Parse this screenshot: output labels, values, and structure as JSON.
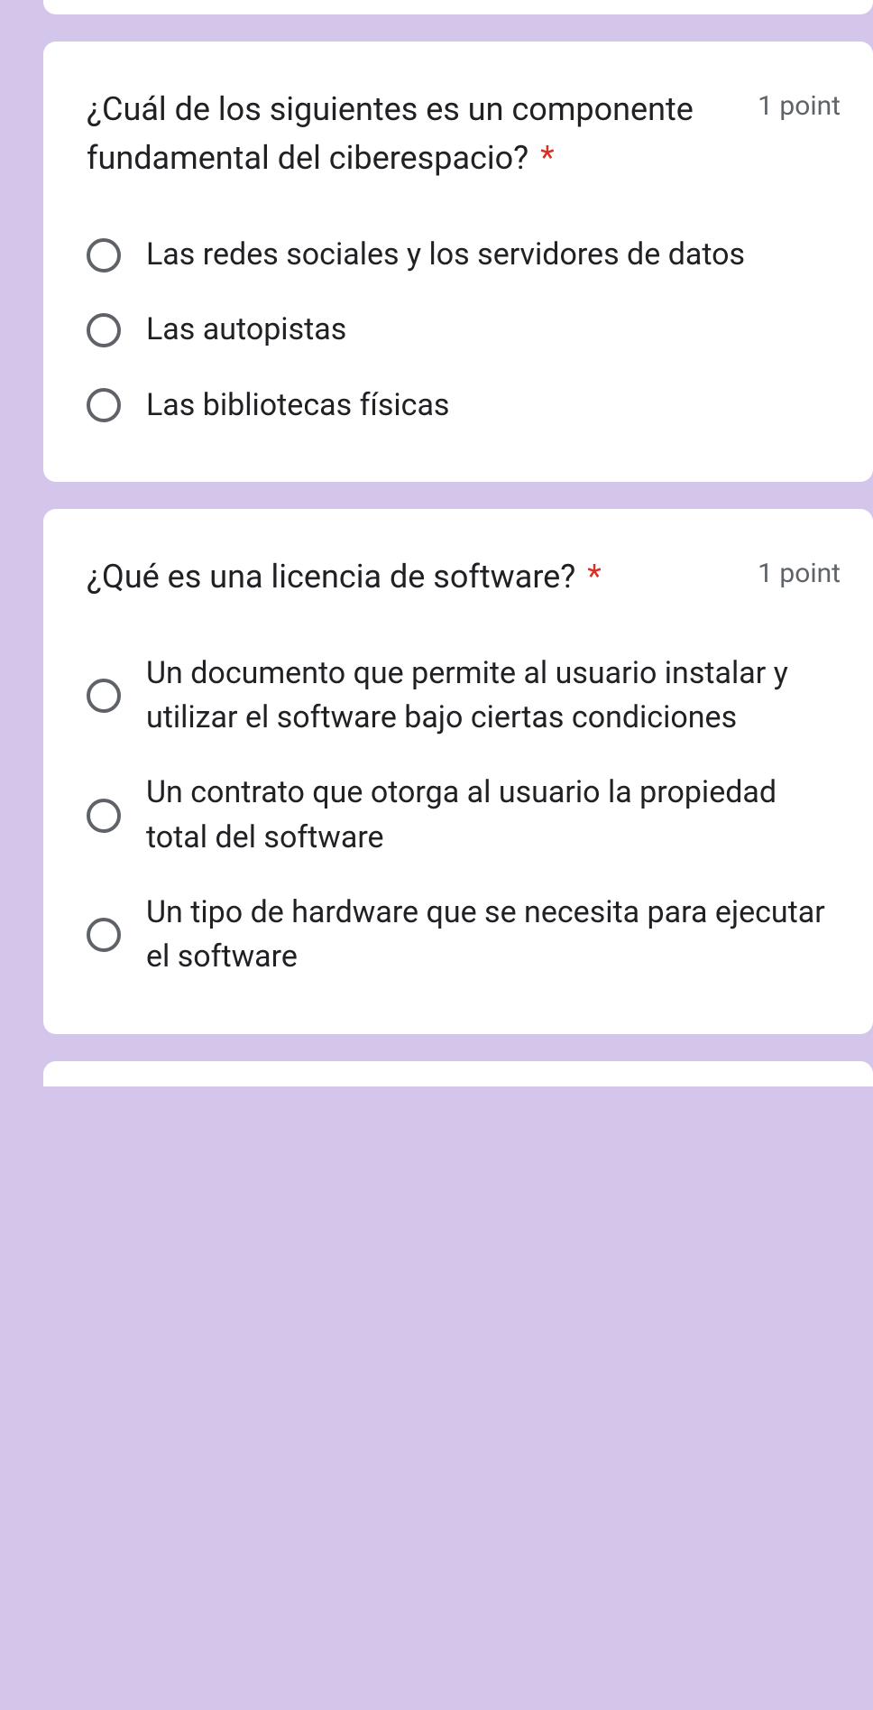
{
  "required_marker": "*",
  "points_label": "1 point",
  "questions": [
    {
      "text": " ¿Cuál de los siguientes es un componente fundamental del ciberespacio?",
      "options": [
        "Las redes sociales y los servidores de datos",
        "Las autopistas",
        "Las bibliotecas físicas"
      ]
    },
    {
      "text": " ¿Qué es una licencia de software?",
      "options": [
        "Un documento que permite al usuario instalar y utilizar el software bajo ciertas condiciones",
        "Un contrato que otorga al usuario la propiedad total del software",
        "Un tipo de hardware que se necesita para ejecutar el software"
      ]
    }
  ]
}
